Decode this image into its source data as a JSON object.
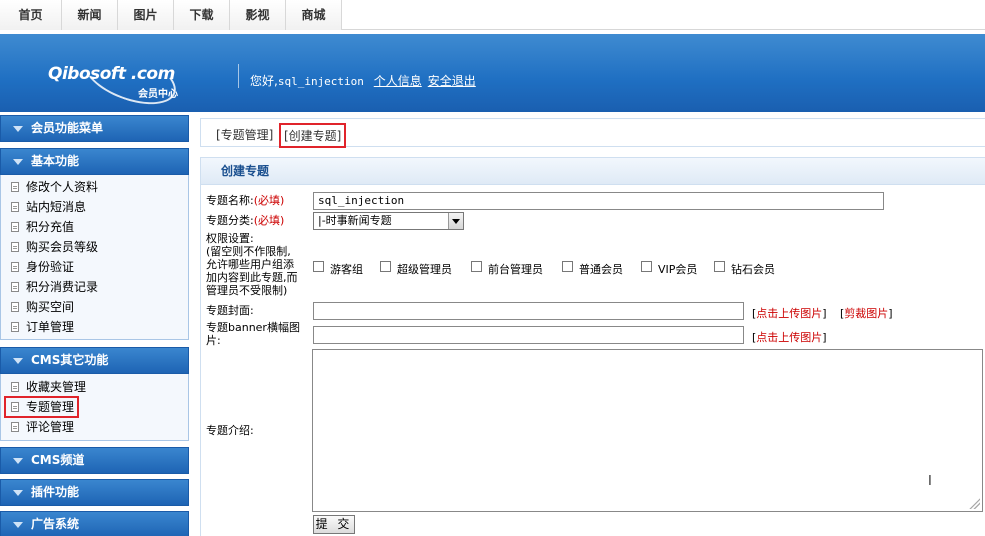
{
  "nav": {
    "tabs": [
      {
        "label": "首页"
      },
      {
        "label": "新闻"
      },
      {
        "label": "图片"
      },
      {
        "label": "下载"
      },
      {
        "label": "影视"
      },
      {
        "label": "商城"
      }
    ]
  },
  "header": {
    "logo_text": "Qibosoft .com",
    "logo_sub": "会员中心",
    "greeting": "您好,",
    "username": "sql_injection",
    "profile_link": "个人信息",
    "logout_link": "安全退出",
    "colors": {
      "header_blue": "#1f6fc2",
      "sidebar_blue": "#1e64b4",
      "highlight_red": "#e0242b"
    }
  },
  "sidebar": {
    "member_menu": "会员功能菜单",
    "basic": {
      "title": "基本功能",
      "items": [
        {
          "label": "修改个人资料"
        },
        {
          "label": "站内短消息"
        },
        {
          "label": "积分充值"
        },
        {
          "label": "购买会员等级"
        },
        {
          "label": "身份验证"
        },
        {
          "label": "积分消费记录"
        },
        {
          "label": "购买空间"
        },
        {
          "label": "订单管理"
        }
      ]
    },
    "cms_other": {
      "title": "CMS其它功能",
      "items": [
        {
          "label": "收藏夹管理"
        },
        {
          "label": "专题管理"
        },
        {
          "label": "评论管理"
        }
      ]
    },
    "cms_channel": "CMS频道",
    "plugins": "插件功能",
    "ads": "广告系统"
  },
  "breadcrumb": {
    "manage": "[专题管理]",
    "create": "[创建专题]"
  },
  "form": {
    "panel_title": "创建专题",
    "name_label": "专题名称:",
    "required": "(必填)",
    "name_value": "sql_injection",
    "category_label": "专题分类:",
    "category_value": "|-时事新闻专题",
    "perm_label_1": "权限设置:",
    "perm_label_2": "(留空则不作限制,",
    "perm_label_3": "允许哪些用户组添",
    "perm_label_4": "加内容到此专题,而",
    "perm_label_5": "管理员不受限制)",
    "groups": [
      {
        "label": "游客组"
      },
      {
        "label": "超级管理员"
      },
      {
        "label": "前台管理员"
      },
      {
        "label": "普通会员"
      },
      {
        "label": "VIP会员"
      },
      {
        "label": "钻石会员"
      }
    ],
    "cover_label": "专题封面:",
    "upload_label": "点击上传图片",
    "crop_label": "剪裁图片",
    "banner_label_1": "专题banner横幅图",
    "banner_label_2": "片:",
    "intro_label": "专题介绍:",
    "submit_label": "提 交"
  },
  "icons": {
    "submenu_arrow": "chevron-down-icon",
    "sidebar_item": "document-icon",
    "cursor": "text-cursor-icon"
  }
}
